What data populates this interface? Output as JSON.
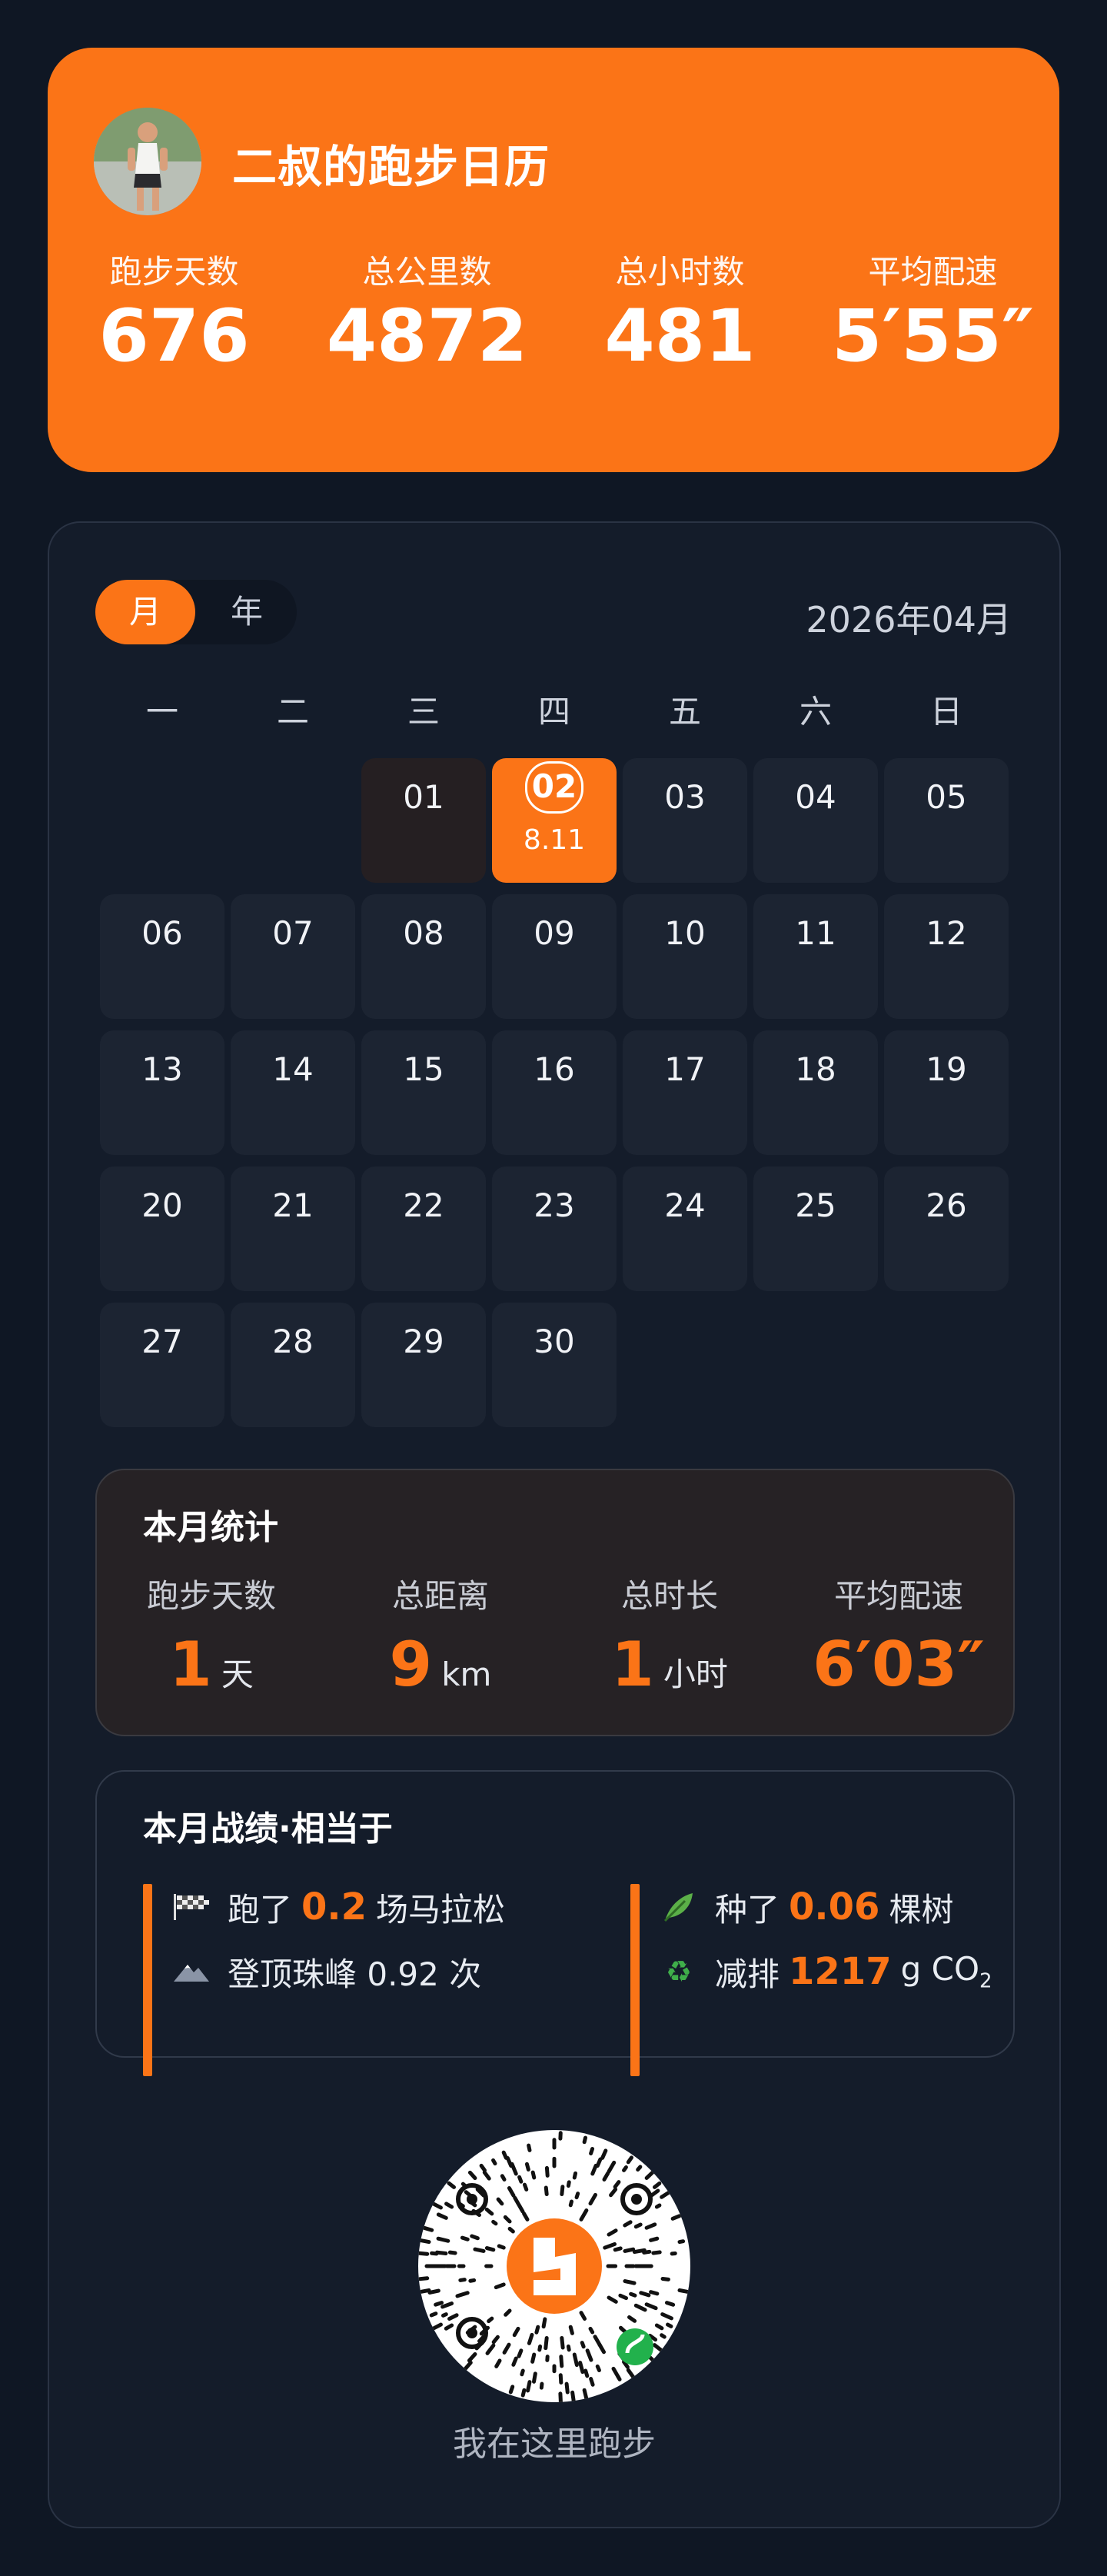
{
  "header": {
    "title": "二叔的跑步日历",
    "stats": [
      {
        "label": "跑步天数",
        "value": "676"
      },
      {
        "label": "总公里数",
        "value": "4872"
      },
      {
        "label": "总小时数",
        "value": "481"
      },
      {
        "label": "平均配速",
        "value": "5′55″"
      }
    ]
  },
  "calendar": {
    "tabs": {
      "month": "月",
      "year": "年"
    },
    "month_label": "2026年04月",
    "weekdays": [
      "一",
      "二",
      "三",
      "四",
      "五",
      "六",
      "日"
    ],
    "days": [
      {
        "num": "01",
        "state": "past"
      },
      {
        "num": "02",
        "state": "today",
        "sub": "8.11"
      },
      {
        "num": "03"
      },
      {
        "num": "04"
      },
      {
        "num": "05"
      },
      {
        "num": "06"
      },
      {
        "num": "07"
      },
      {
        "num": "08"
      },
      {
        "num": "09"
      },
      {
        "num": "10"
      },
      {
        "num": "11"
      },
      {
        "num": "12"
      },
      {
        "num": "13"
      },
      {
        "num": "14"
      },
      {
        "num": "15"
      },
      {
        "num": "16"
      },
      {
        "num": "17"
      },
      {
        "num": "18"
      },
      {
        "num": "19"
      },
      {
        "num": "20"
      },
      {
        "num": "21"
      },
      {
        "num": "22"
      },
      {
        "num": "23"
      },
      {
        "num": "24"
      },
      {
        "num": "25"
      },
      {
        "num": "26"
      },
      {
        "num": "27"
      },
      {
        "num": "28"
      },
      {
        "num": "29"
      },
      {
        "num": "30"
      }
    ]
  },
  "month_stats": {
    "title": "本月统计",
    "items": [
      {
        "label": "跑步天数",
        "value": "1",
        "unit": "天"
      },
      {
        "label": "总距离",
        "value": "9",
        "unit": "km"
      },
      {
        "label": "总时长",
        "value": "1",
        "unit": "小时"
      },
      {
        "label": "平均配速",
        "value": "6′03″",
        "unit": ""
      }
    ]
  },
  "achievements": {
    "title": "本月战绩·相当于",
    "marathon": {
      "prefix": "跑了",
      "value": "0.2",
      "suffix": "场马拉松",
      "icon": "checkered-flag-icon"
    },
    "everest": {
      "text": "登顶珠峰 0.92 次",
      "icon": "mountain-icon"
    },
    "trees": {
      "prefix": "种了",
      "value": "0.06",
      "suffix": "棵树",
      "icon": "leaf-icon"
    },
    "emission": {
      "prefix": "减排",
      "value": "1217",
      "suffix": "g CO",
      "sub": "2",
      "icon": "recycle-icon"
    }
  },
  "footer": {
    "caption": "我在这里跑步"
  },
  "colors": {
    "accent": "#fb7417",
    "background": "#0f1724",
    "card": "#141c2a"
  }
}
